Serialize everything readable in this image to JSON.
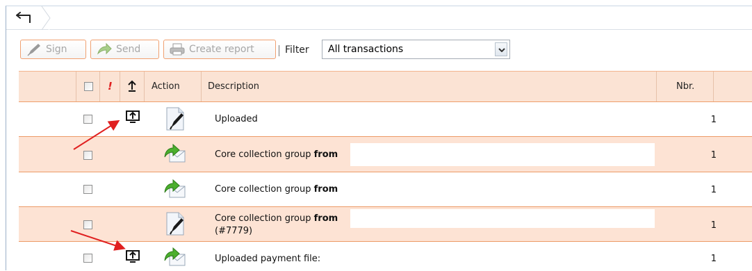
{
  "toolbar": {
    "sign_label": "Sign",
    "send_label": "Send",
    "create_report_label": "Create report",
    "filter_label": "Filter",
    "filter_value": "All transactions"
  },
  "table": {
    "headers": {
      "exclamation": "!",
      "upload": "↥",
      "action": "Action",
      "description": "Description",
      "nbr": "Nbr."
    },
    "rows": [
      {
        "desc_prefix": "Uploaded",
        "desc_bold": "",
        "desc_line2": "",
        "nbr": "1",
        "upload_icon": true,
        "action_icon": "document-pen-icon"
      },
      {
        "desc_prefix": "Core collection group ",
        "desc_bold": "from",
        "desc_line2": "",
        "nbr": "1",
        "upload_icon": false,
        "action_icon": "send-envelope-icon"
      },
      {
        "desc_prefix": "Core collection group ",
        "desc_bold": "from",
        "desc_line2": "",
        "nbr": "1",
        "upload_icon": false,
        "action_icon": "send-envelope-icon"
      },
      {
        "desc_prefix": "Core collection group ",
        "desc_bold": "from",
        "desc_line2": "(#7779)",
        "nbr": "1",
        "upload_icon": false,
        "action_icon": "document-pen-icon"
      },
      {
        "desc_prefix": "Uploaded payment file:",
        "desc_bold": "",
        "desc_line2": "",
        "nbr": "1",
        "upload_icon": true,
        "action_icon": "send-envelope-icon"
      }
    ]
  },
  "colors": {
    "accent_orange": "#ec9a66",
    "row_alt": "#fde3d4",
    "annotation_red": "#e02020"
  }
}
